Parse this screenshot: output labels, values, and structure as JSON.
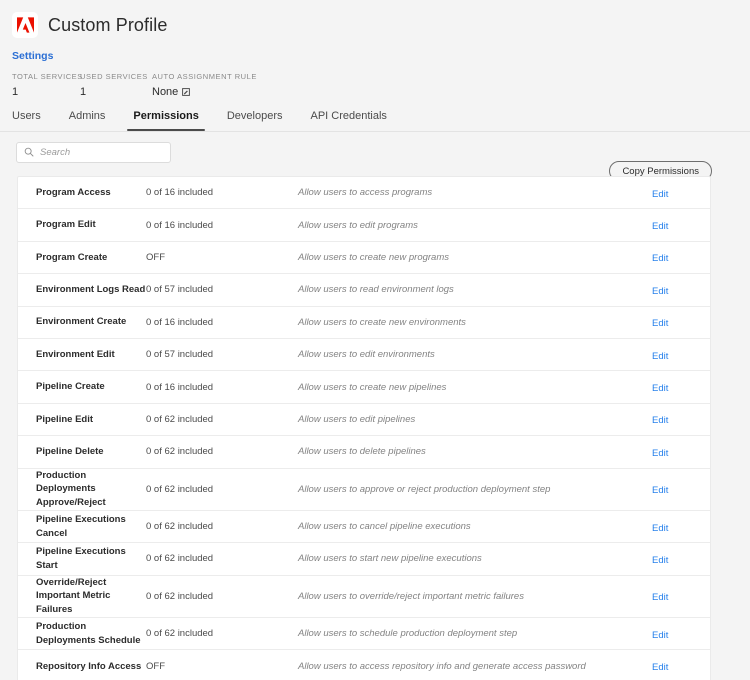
{
  "header": {
    "logo_icon": "adobe-logo-icon",
    "title": "Custom Profile",
    "settings_link": "Settings",
    "metrics": [
      {
        "label": "TOTAL SERVICES",
        "value": "1"
      },
      {
        "label": "USED SERVICES",
        "value": "1"
      },
      {
        "label": "AUTO ASSIGNMENT RULE",
        "value": "None",
        "icon": "edit-square-icon"
      }
    ]
  },
  "tabs": [
    {
      "label": "Users",
      "active": false
    },
    {
      "label": "Admins",
      "active": false
    },
    {
      "label": "Permissions",
      "active": true
    },
    {
      "label": "Developers",
      "active": false
    },
    {
      "label": "API Credentials",
      "active": false
    }
  ],
  "toolbar": {
    "search_placeholder": "Search",
    "search_value": "",
    "search_icon": "search-icon",
    "copy_permissions_label": "Copy Permissions"
  },
  "table": {
    "edit_label": "Edit",
    "rows": [
      {
        "name": "Program Access",
        "count": "0 of 16 included",
        "description": "Allow users to access programs"
      },
      {
        "name": "Program Edit",
        "count": "0 of 16 included",
        "description": "Allow users to edit programs"
      },
      {
        "name": "Program Create",
        "count": "OFF",
        "description": "Allow users to create new programs"
      },
      {
        "name": "Environment Logs Read",
        "count": "0 of 57 included",
        "description": "Allow users to read environment logs"
      },
      {
        "name": "Environment Create",
        "count": "0 of 16 included",
        "description": "Allow users to create new environments"
      },
      {
        "name": "Environment Edit",
        "count": "0 of 57 included",
        "description": "Allow users to edit environments"
      },
      {
        "name": "Pipeline Create",
        "count": "0 of 16 included",
        "description": "Allow users to create new pipelines"
      },
      {
        "name": "Pipeline Edit",
        "count": "0 of 62 included",
        "description": "Allow users to edit pipelines"
      },
      {
        "name": "Pipeline Delete",
        "count": "0 of 62 included",
        "description": "Allow users to delete pipelines"
      },
      {
        "name": "Production Deployments Approve/Reject",
        "count": "0 of 62 included",
        "description": "Allow users to approve or reject production deployment step"
      },
      {
        "name": "Pipeline Executions Cancel",
        "count": "0 of 62 included",
        "description": "Allow users to cancel pipeline executions"
      },
      {
        "name": "Pipeline Executions Start",
        "count": "0 of 62 included",
        "description": "Allow users to start new pipeline executions"
      },
      {
        "name": "Override/Reject Important Metric Failures",
        "count": "0 of 62 included",
        "description": "Allow users to override/reject important metric failures"
      },
      {
        "name": "Production Deployments Schedule",
        "count": "0 of 62 included",
        "description": "Allow users to schedule production deployment step"
      },
      {
        "name": "Repository Info Access",
        "count": "OFF",
        "description": "Allow users to access repository info and generate access password"
      }
    ]
  },
  "colors": {
    "accent_link": "#2680eb",
    "settings_link": "#2b6fd4",
    "brand_red": "#eb1000",
    "page_bg": "#f4f4f4",
    "card_bg": "#ffffff"
  }
}
